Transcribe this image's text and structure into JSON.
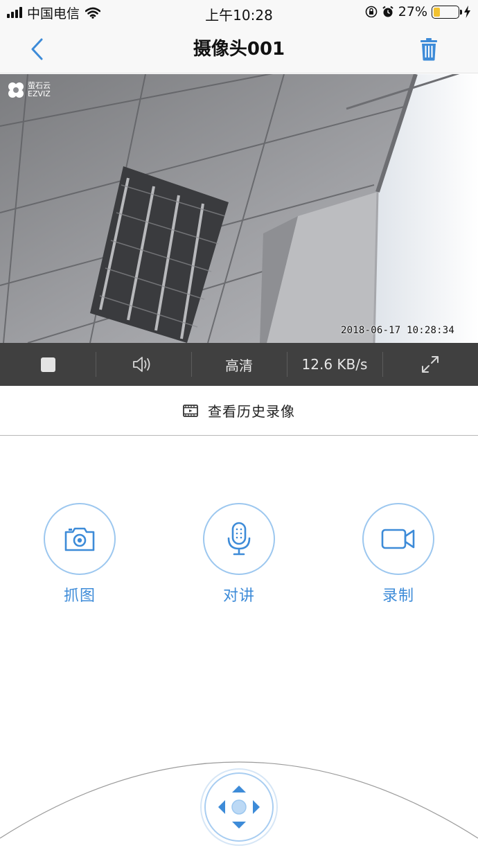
{
  "status_bar": {
    "carrier": "中国电信",
    "time": "上午10:28",
    "battery_percent": "27%",
    "battery_level": 0.27,
    "icons": [
      "signal-icon",
      "wifi-icon",
      "orientation-lock-icon",
      "alarm-icon",
      "battery-icon",
      "charging-icon"
    ]
  },
  "nav": {
    "title": "摄像头001",
    "back_icon": "chevron-left-icon",
    "delete_icon": "trash-icon"
  },
  "video": {
    "logo_text_cn": "萤石云",
    "logo_text_en": "EZVIZ",
    "timestamp": "2018-06-17 10:28:34"
  },
  "controls": {
    "stop_icon": "stop-icon",
    "sound_icon": "speaker-icon",
    "quality": "高清",
    "bitrate": "12.6 KB/s",
    "fullscreen_icon": "fullscreen-icon"
  },
  "history": {
    "label": "查看历史录像",
    "icon": "film-icon"
  },
  "actions": [
    {
      "label": "抓图",
      "icon": "camera-icon"
    },
    {
      "label": "对讲",
      "icon": "microphone-icon"
    },
    {
      "label": "录制",
      "icon": "video-camera-icon"
    }
  ],
  "ptz": {
    "icon": "direction-pad-icon"
  },
  "colors": {
    "accent": "#3d8bd8",
    "ring": "#9cc7ef",
    "control_bar": "#404040",
    "bar_bg": "#f8f8f8"
  }
}
